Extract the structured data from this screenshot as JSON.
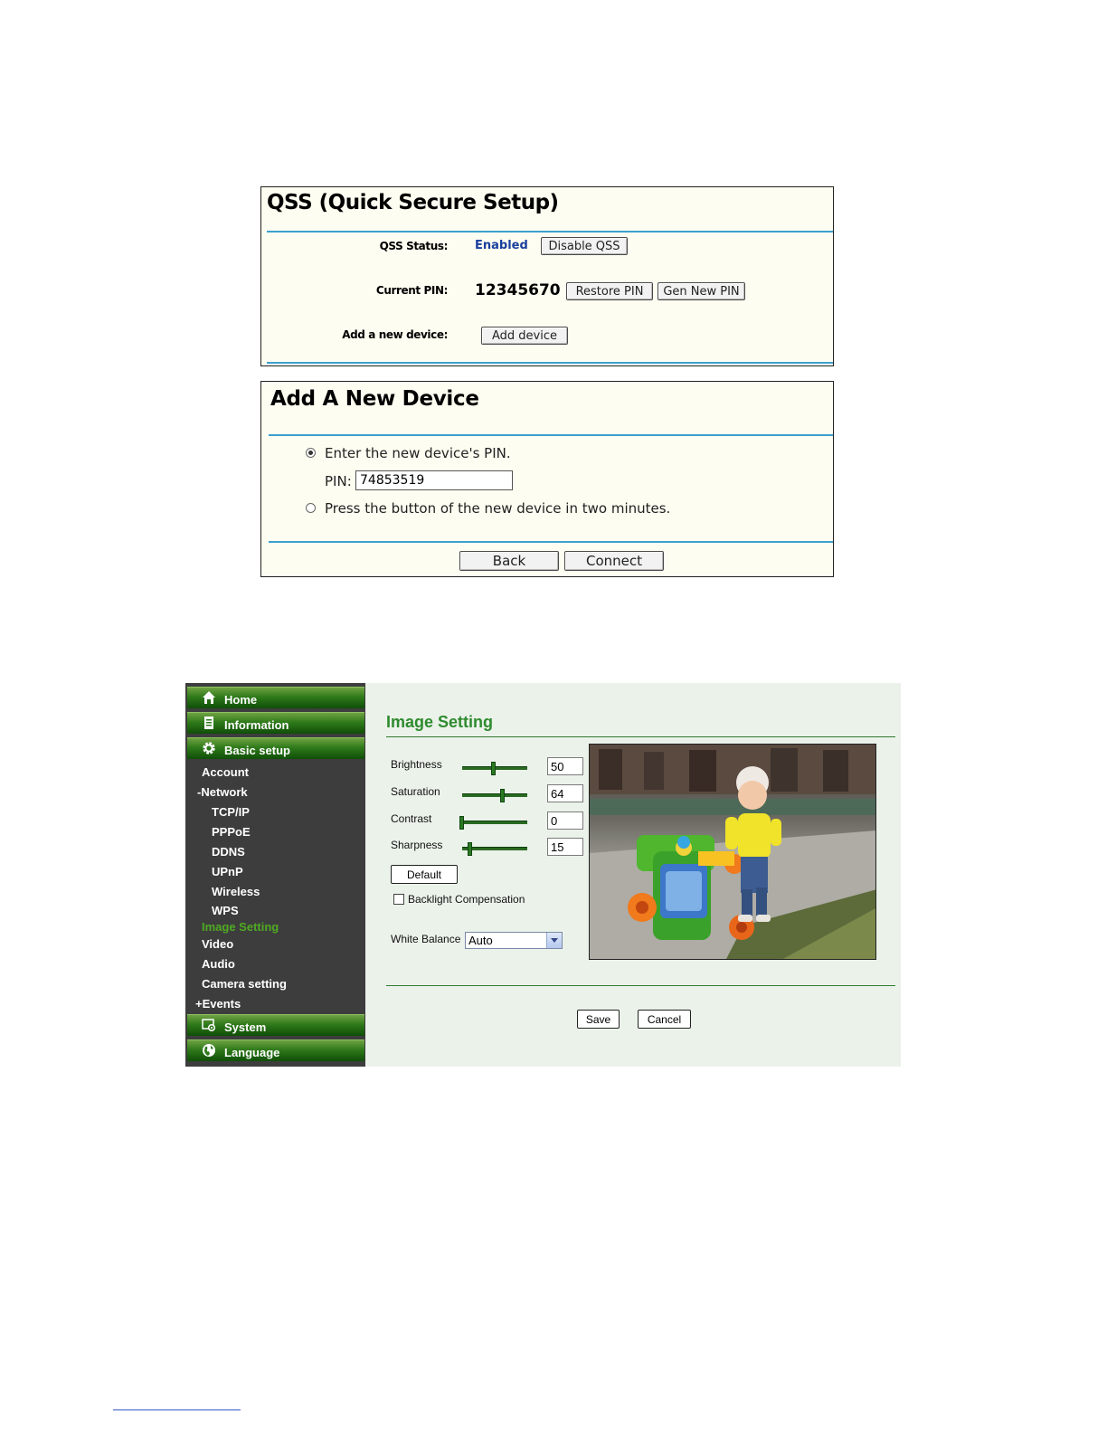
{
  "qss": {
    "title": "QSS (Quick Secure Setup)",
    "status_label": "QSS Status:",
    "status_value": "Enabled",
    "disable_button": "Disable QSS",
    "pin_label": "Current PIN:",
    "pin_value": "12345670",
    "restore_button": "Restore PIN",
    "gen_button": "Gen New PIN",
    "add_label": "Add a new device:",
    "add_button": "Add device"
  },
  "add_device": {
    "title": "Add A New Device",
    "option_pin": "Enter the new device's PIN.",
    "pin_label": "PIN:",
    "pin_value": "74853519",
    "option_button": "Press the button of the new device in two minutes.",
    "selected_option": "pin",
    "back_button": "Back",
    "connect_button": "Connect"
  },
  "camera": {
    "nav": {
      "home": "Home",
      "information": "Information",
      "basic_setup": "Basic setup",
      "account": "Account",
      "network": "-Network",
      "tcpip": "TCP/IP",
      "pppoe": "PPPoE",
      "ddns": "DDNS",
      "upnp": "UPnP",
      "wireless": "Wireless",
      "wps": "WPS",
      "image_setting": "Image Setting",
      "video": "Video",
      "audio": "Audio",
      "camera_setting": "Camera setting",
      "events": "+Events",
      "system": "System",
      "language": "Language"
    },
    "title": "Image Setting",
    "brightness_label": "Brightness",
    "brightness_value": "50",
    "saturation_label": "Saturation",
    "saturation_value": "64",
    "contrast_label": "Contrast",
    "contrast_value": "0",
    "sharpness_label": "Sharpness",
    "sharpness_value": "15",
    "default_button": "Default",
    "backlight_label": "Backlight Compensation",
    "white_balance_label": "White Balance",
    "white_balance_value": "Auto",
    "save_button": "Save",
    "cancel_button": "Cancel",
    "colors": {
      "accent_green": "#2e8b2e",
      "sidebar": "#3d3d3d",
      "active_item": "#4faa22"
    }
  }
}
